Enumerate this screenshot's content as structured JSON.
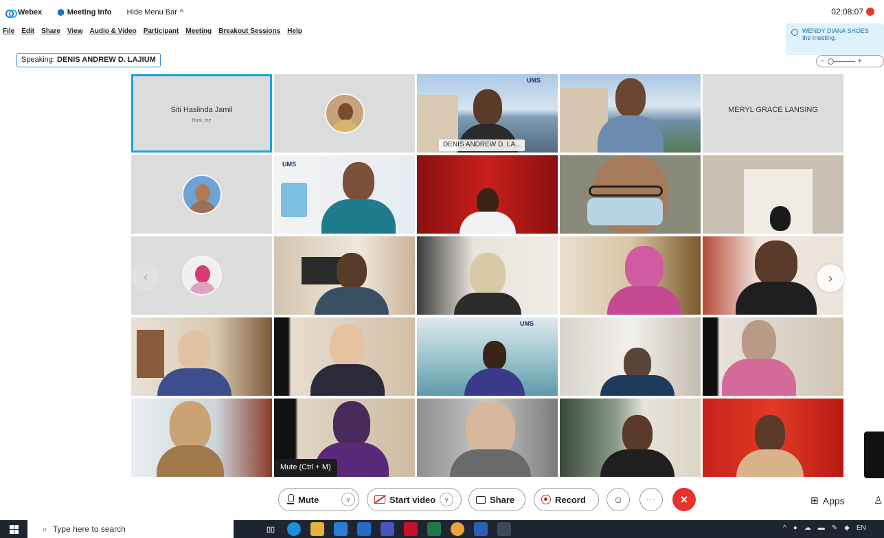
{
  "titlebar": {
    "app_name": "Webex",
    "meeting_info": "Meeting Info",
    "hide_menu": "Hide Menu Bar",
    "hide_menu_chevron": "^",
    "time": "02:08:07"
  },
  "menubar": {
    "items": [
      "File",
      "Edit",
      "Share",
      "View",
      "Audio & Video",
      "Participant",
      "Meeting",
      "Breakout Sessions",
      "Help"
    ]
  },
  "speaking": {
    "prefix": "Speaking:",
    "name": "DENIS ANDREW D. LAJIUM"
  },
  "notification": {
    "text": "WENDY DIANA SHOES",
    "text2": "the meeting."
  },
  "zoom": {
    "minus": "−",
    "plus": "+"
  },
  "tiles": [
    {
      "type": "name",
      "name": "Siti Haslinda Jamil",
      "sub": "Host, me"
    },
    {
      "type": "avatar"
    },
    {
      "type": "video",
      "nametag": "DENIS ANDREW D. LA...",
      "banner": "UMS"
    },
    {
      "type": "video"
    },
    {
      "type": "name",
      "name": "MERYL GRACE LANSING"
    },
    {
      "type": "avatar"
    },
    {
      "type": "video",
      "banner": "UMS"
    },
    {
      "type": "video"
    },
    {
      "type": "video"
    },
    {
      "type": "video"
    },
    {
      "type": "avatar"
    },
    {
      "type": "video"
    },
    {
      "type": "video"
    },
    {
      "type": "video"
    },
    {
      "type": "video"
    },
    {
      "type": "video"
    },
    {
      "type": "video"
    },
    {
      "type": "video",
      "banner": "UMS"
    },
    {
      "type": "video"
    },
    {
      "type": "video"
    },
    {
      "type": "video"
    },
    {
      "type": "video"
    },
    {
      "type": "video"
    },
    {
      "type": "video"
    },
    {
      "type": "video"
    }
  ],
  "nav": {
    "prev": "‹",
    "next": "›"
  },
  "tooltip": "Mute (Ctrl + M)",
  "controls": {
    "mute": "Mute",
    "start_video": "Start video",
    "share": "Share",
    "record": "Record",
    "apps": "Apps",
    "chevron": "v",
    "more": "···",
    "leave": "×",
    "reactions": "☺"
  },
  "taskbar": {
    "search_placeholder": "Type here to search",
    "tray_lang": "EN"
  },
  "colors": {
    "accent": "#1aa3e0",
    "leave": "#e5322d",
    "record": "#c62828"
  }
}
